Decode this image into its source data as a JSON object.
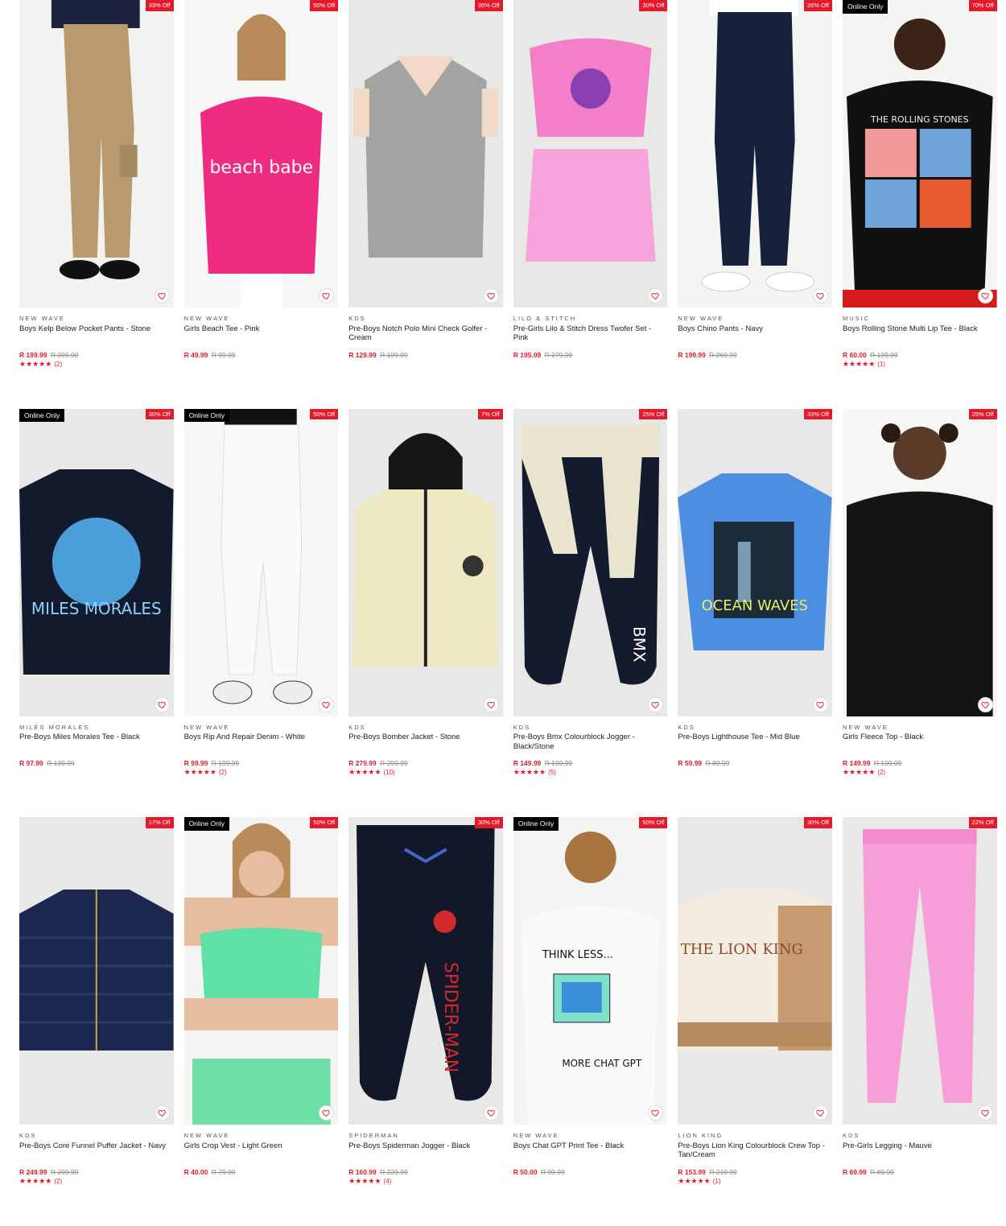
{
  "colors": {
    "accent": "#e21a2c",
    "online_badge": "#000000",
    "was_price": "#8a8a8a"
  },
  "products": [
    {
      "brand": "NEW WAVE",
      "name": "Boys Kelp Below Pocket Pants - Stone",
      "price": "R 199.99",
      "was": "R 299.99",
      "discount": "33% Off",
      "online_only": "",
      "stars": "★★★★★",
      "reviews": "(2)",
      "image": "boy-cargo-pants"
    },
    {
      "brand": "NEW WAVE",
      "name": "Girls Beach Tee - Pink",
      "price": "R 49.99",
      "was": "R 99.99",
      "discount": "50% Off",
      "online_only": "",
      "stars": "",
      "reviews": "",
      "image": "girl-pink-tee"
    },
    {
      "brand": "KDS",
      "name": "Pre-Boys Notch Polo Mini Check Golfer - Cream",
      "price": "R 129.99",
      "was": "R 199.99",
      "discount": "35% Off",
      "online_only": "",
      "stars": "",
      "reviews": "",
      "image": "check-golfer"
    },
    {
      "brand": "LILO & STITCH",
      "name": "Pre-Girls Lilo & Stitch Dress Twofer Set - Pink",
      "price": "R 195.99",
      "was": "R 279.99",
      "discount": "30% Off",
      "online_only": "",
      "stars": "",
      "reviews": "",
      "image": "pink-dress-set"
    },
    {
      "brand": "NEW WAVE",
      "name": "Boys Chino Pants - Navy",
      "price": "R 199.99",
      "was": "R 269.99",
      "discount": "26% Off",
      "online_only": "",
      "stars": "",
      "reviews": "",
      "image": "navy-chino"
    },
    {
      "brand": "MUSIC",
      "name": "Boys Rolling Stone Multi Lip Tee - Black",
      "price": "R 60.00",
      "was": "R 199.99",
      "discount": "70% Off",
      "online_only": "Online Only",
      "stars": "★★★★★",
      "reviews": "(1)",
      "image": "rolling-stones-tee"
    },
    {
      "brand": "MILES MORALES",
      "name": "Pre-Boys Miles Morales Tee - Black",
      "price": "R 97.99",
      "was": "R 139.99",
      "discount": "30% Off",
      "online_only": "Online Only",
      "stars": "",
      "reviews": "",
      "image": "miles-morales-tee"
    },
    {
      "brand": "NEW WAVE",
      "name": "Boys Rip And Repair Denim - White",
      "price": "R 99.99",
      "was": "R 199.99",
      "discount": "50% Off",
      "online_only": "Online Only",
      "stars": "★★★★★",
      "reviews": "(2)",
      "image": "white-denim"
    },
    {
      "brand": "KDS",
      "name": "Pre-Boys Bomber Jacket - Stone",
      "price": "R 279.99",
      "was": "R 299.99",
      "discount": "7% Off",
      "online_only": "",
      "stars": "★★★★★",
      "reviews": "(10)",
      "image": "bomber-jacket"
    },
    {
      "brand": "KDS",
      "name": "Pre-Boys Bmx Colourblock Jogger - Black/Stone",
      "price": "R 149.99",
      "was": "R 199.99",
      "discount": "25% Off",
      "online_only": "",
      "stars": "★★★★★",
      "reviews": "(5)",
      "image": "bmx-jogger"
    },
    {
      "brand": "KDS",
      "name": "Pre-Boys Lighthouse Tee - Mid Blue",
      "price": "R 59.99",
      "was": "R 89.99",
      "discount": "33% Off",
      "online_only": "",
      "stars": "",
      "reviews": "",
      "image": "ocean-waves-tee"
    },
    {
      "brand": "NEW WAVE",
      "name": "Girls Fleece Top - Black",
      "price": "R 149.99",
      "was": "R 199.99",
      "discount": "25% Off",
      "online_only": "",
      "stars": "★★★★★",
      "reviews": "(2)",
      "image": "girl-fleece-top"
    },
    {
      "brand": "KDS",
      "name": "Pre-Boys Core Funnel Puffer Jacket - Navy",
      "price": "R 249.99",
      "was": "R 299.99",
      "discount": "17% Off",
      "online_only": "",
      "stars": "★★★★★",
      "reviews": "(2)",
      "image": "puffer-jacket"
    },
    {
      "brand": "NEW WAVE",
      "name": "Girls Crop Vest - Light Green",
      "price": "R 40.00",
      "was": "R 79.99",
      "discount": "50% Off",
      "online_only": "Online Only",
      "stars": "",
      "reviews": "",
      "image": "green-crop-vest"
    },
    {
      "brand": "SPIDERMAN",
      "name": "Pre-Boys Spiderman Jogger - Black",
      "price": "R 160.99",
      "was": "R 229.99",
      "discount": "30% Off",
      "online_only": "",
      "stars": "★★★★★",
      "reviews": "(4)",
      "image": "spiderman-jogger"
    },
    {
      "brand": "NEW WAVE",
      "name": "Boys Chat GPT Print Tee - Black",
      "price": "R 50.00",
      "was": "R 99.99",
      "discount": "50% Off",
      "online_only": "Online Only",
      "stars": "",
      "reviews": "",
      "image": "chat-gpt-tee"
    },
    {
      "brand": "LION KING",
      "name": "Pre-Boys Lion King Colourblock Crew Top - Tan/Cream",
      "price": "R 153.99",
      "was": "R 219.99",
      "discount": "30% Off",
      "online_only": "",
      "stars": "★★★★★",
      "reviews": "(1)",
      "image": "lion-king-top"
    },
    {
      "brand": "KDS",
      "name": "Pre-Girls Legging - Mauve",
      "price": "R 69.99",
      "was": "R 89.99",
      "discount": "22% Off",
      "online_only": "",
      "stars": "",
      "reviews": "",
      "image": "mauve-legging"
    }
  ]
}
